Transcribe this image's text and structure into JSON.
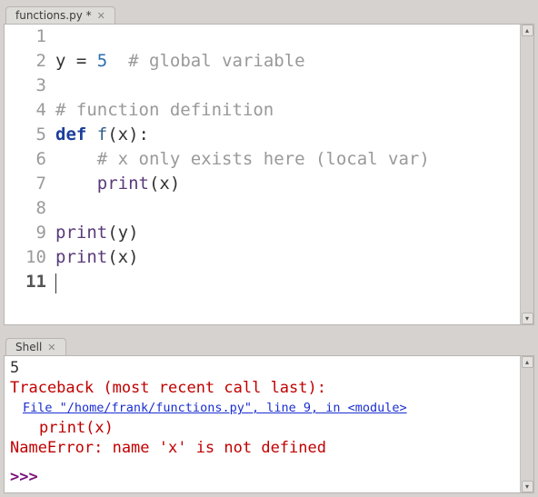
{
  "editor": {
    "tab_label": "functions.py *",
    "lines": [
      {
        "n": "1",
        "tokens": []
      },
      {
        "n": "2",
        "tokens": [
          {
            "t": "y ",
            "c": ""
          },
          {
            "t": "=",
            "c": ""
          },
          {
            "t": " ",
            "c": ""
          },
          {
            "t": "5",
            "c": "num"
          },
          {
            "t": "  ",
            "c": ""
          },
          {
            "t": "# global variable",
            "c": "com"
          }
        ]
      },
      {
        "n": "3",
        "tokens": []
      },
      {
        "n": "4",
        "tokens": [
          {
            "t": "# function definition",
            "c": "com"
          }
        ]
      },
      {
        "n": "5",
        "tokens": [
          {
            "t": "def",
            "c": "kw"
          },
          {
            "t": " ",
            "c": ""
          },
          {
            "t": "f",
            "c": "fnname"
          },
          {
            "t": "(x):",
            "c": ""
          }
        ]
      },
      {
        "n": "6",
        "tokens": [
          {
            "t": "    ",
            "c": ""
          },
          {
            "t": "# x only exists here (local var)",
            "c": "com"
          }
        ]
      },
      {
        "n": "7",
        "tokens": [
          {
            "t": "    ",
            "c": ""
          },
          {
            "t": "print",
            "c": "fncall"
          },
          {
            "t": "(x)",
            "c": ""
          }
        ]
      },
      {
        "n": "8",
        "tokens": []
      },
      {
        "n": "9",
        "tokens": [
          {
            "t": "print",
            "c": "fncall"
          },
          {
            "t": "(y)",
            "c": ""
          }
        ]
      },
      {
        "n": "10",
        "tokens": [
          {
            "t": "print",
            "c": "fncall"
          },
          {
            "t": "(x)",
            "c": ""
          }
        ]
      },
      {
        "n": "11",
        "tokens": [],
        "cursor": true
      }
    ]
  },
  "shell": {
    "tab_label": "Shell",
    "output": [
      {
        "type": "out",
        "text": "5"
      },
      {
        "type": "err",
        "text": "Traceback (most recent call last):"
      },
      {
        "type": "link",
        "text": "File \"/home/frank/functions.py\", line 9, in <module>"
      },
      {
        "type": "err-indent",
        "text": "print(x)"
      },
      {
        "type": "err",
        "text": "NameError: name 'x' is not defined"
      }
    ],
    "prompt": ">>>"
  }
}
